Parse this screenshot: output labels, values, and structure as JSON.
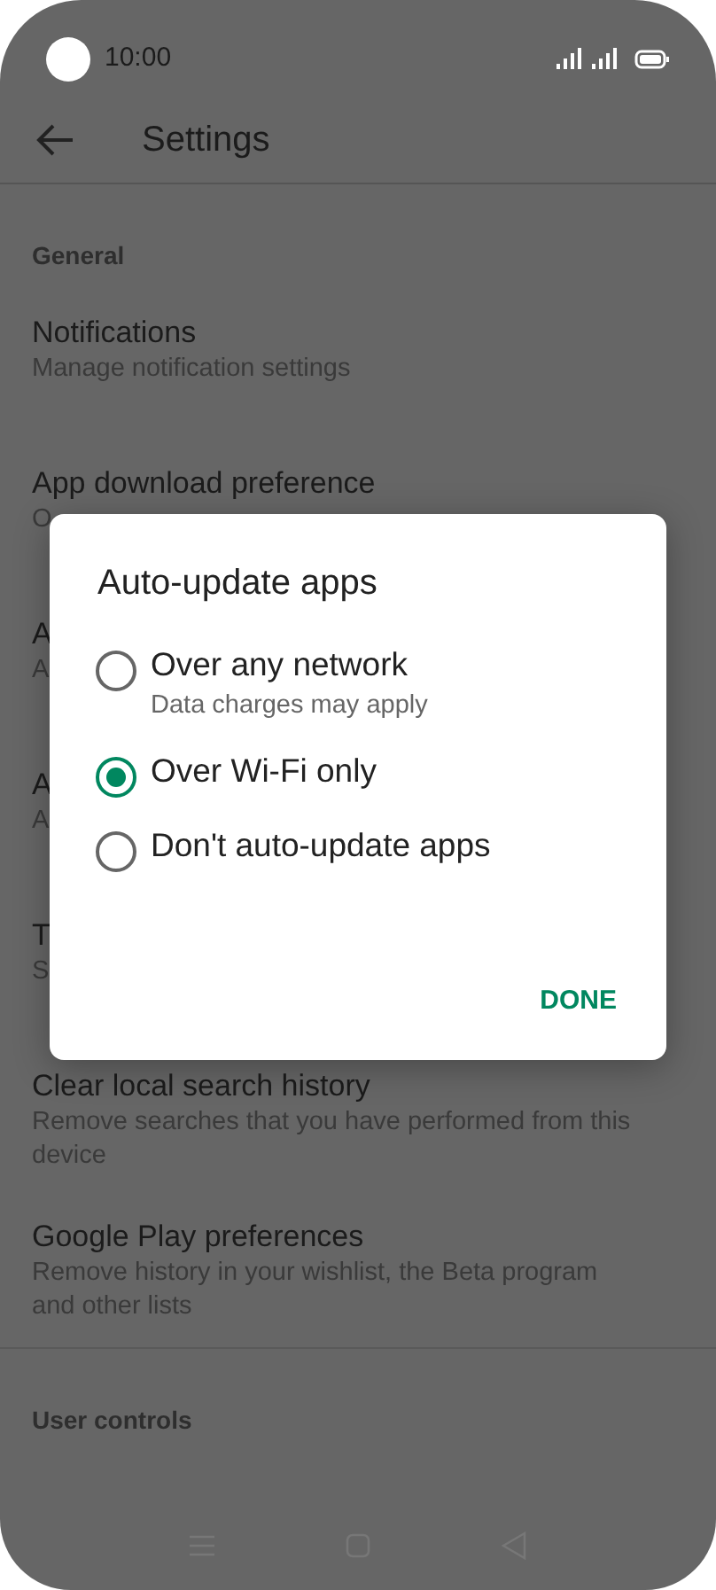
{
  "status_bar": {
    "time": "10:00"
  },
  "toolbar": {
    "title": "Settings"
  },
  "sections": [
    {
      "header": "General",
      "items": [
        {
          "title": "Notifications",
          "subtitle": "Manage notification settings"
        },
        {
          "title": "App download preference",
          "subtitle": "O"
        },
        {
          "title": "A",
          "subtitle": "A"
        },
        {
          "title": "A",
          "subtitle": "A"
        },
        {
          "title": "T",
          "subtitle": "S"
        },
        {
          "title": "Clear local search history",
          "subtitle": "Remove searches that you have performed from this device"
        },
        {
          "title": "Google Play preferences",
          "subtitle": "Remove history in your wishlist, the Beta program and other lists"
        }
      ]
    },
    {
      "header": "User controls"
    }
  ],
  "dialog": {
    "title": "Auto-update apps",
    "options": [
      {
        "label": "Over any network",
        "hint": "Data charges may apply",
        "selected": false
      },
      {
        "label": "Over Wi-Fi only",
        "selected": true
      },
      {
        "label": "Don't auto-update apps",
        "selected": false
      }
    ],
    "button": "DONE"
  }
}
